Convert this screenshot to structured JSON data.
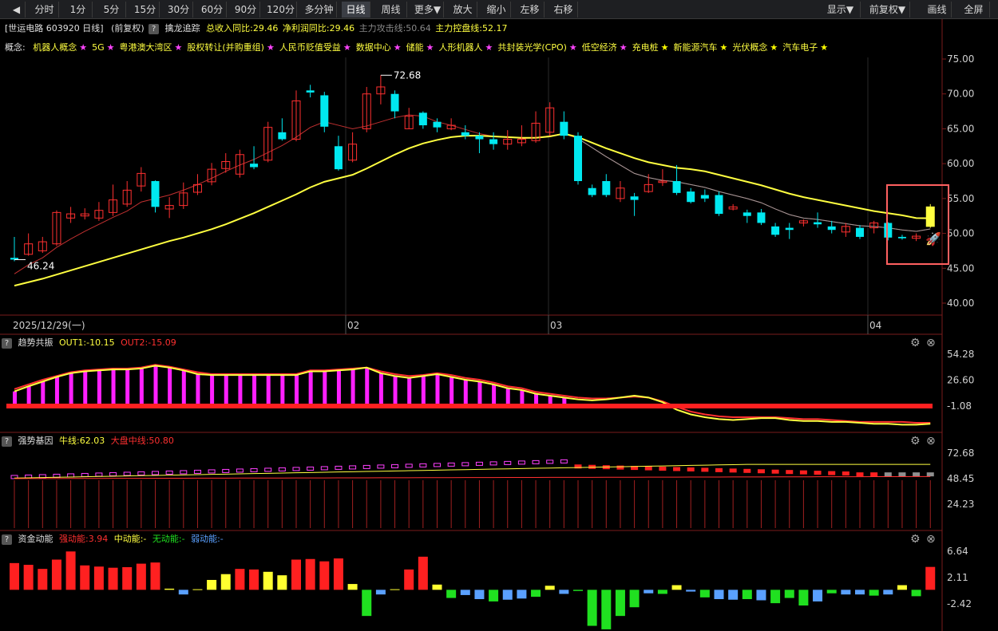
{
  "toolbar": {
    "nav_left": "◀",
    "periods": [
      "分时",
      "1分",
      "5分",
      "15分",
      "30分",
      "60分",
      "90分",
      "120分",
      "多分钟",
      "日线",
      "周线",
      "更多▼",
      "放大",
      "缩小",
      "左移",
      "右移"
    ],
    "active_period": "日线",
    "right_buttons": [
      "显示▼",
      "前复权▼",
      "画线",
      "全屏"
    ]
  },
  "info": {
    "stock": "[世运电路 603920 日线]",
    "adjust": "(前复权)",
    "indicator_name": "擒龙追踪",
    "revenue_yoy": "总收入同比:29.46",
    "profit_yoy": "净利润同比:29.46",
    "attack_line": "主力攻击线:50.64",
    "control_line": "主力控盘线:52.17"
  },
  "concepts": {
    "prefix": "概念:",
    "items": [
      {
        "label": "机器人概念",
        "star": "★",
        "star_color": "#ff44ff"
      },
      {
        "label": "5G",
        "star": "★",
        "star_color": "#ff44ff"
      },
      {
        "label": "粤港澳大湾区",
        "star": "★",
        "star_color": "#ff44ff"
      },
      {
        "label": "股权转让(并购重组)",
        "star": "★",
        "star_color": "#ff44ff"
      },
      {
        "label": "人民币贬值受益",
        "star": "★",
        "star_color": "#ff44ff"
      },
      {
        "label": "数据中心",
        "star": "★",
        "star_color": "#ff44ff"
      },
      {
        "label": "储能",
        "star": "★",
        "star_color": "#ff44ff"
      },
      {
        "label": "人形机器人",
        "star": "★",
        "star_color": "#ff44ff"
      },
      {
        "label": "共封装光学(CPO)",
        "star": "★",
        "star_color": "#ff44ff"
      },
      {
        "label": "低空经济",
        "star": "★",
        "star_color": "#ff44ff"
      },
      {
        "label": "充电桩",
        "star": "★",
        "star_color": "#ffff00"
      },
      {
        "label": "新能源汽车",
        "star": "★",
        "star_color": "#ffff00"
      },
      {
        "label": "光伏概念",
        "star": "★",
        "star_color": "#ffff00"
      },
      {
        "label": "汽车电子",
        "star": "★",
        "star_color": "#ffff00"
      }
    ]
  },
  "price_axis": [
    "75.00",
    "70.00",
    "65.00",
    "60.00",
    "55.00",
    "50.00",
    "45.00",
    "40.00"
  ],
  "date_axis": {
    "first": "2025/12/29(一)",
    "months": [
      "02",
      "03",
      "04"
    ]
  },
  "price_marks": {
    "high": "72.68",
    "low": "46.24"
  },
  "panels": {
    "trend": {
      "name": "趋势共振",
      "out1": "OUT1:-10.15",
      "out2": "OUT2:-15.09",
      "axis": [
        "54.28",
        "26.60",
        "-1.08"
      ]
    },
    "gene": {
      "name": "强势基因",
      "bull": "牛线:62.03",
      "market": "大盘中线:50.80",
      "axis": [
        "72.68",
        "48.45",
        "24.23"
      ]
    },
    "fund": {
      "name": "资金动能",
      "strong": "强动能:3.94",
      "mid": "中动能:-",
      "none": "无动能:-",
      "weak": "弱动能:-",
      "axis": [
        "6.64",
        "2.11",
        "-2.42"
      ]
    }
  },
  "colors": {
    "up": "#ff3030",
    "down": "#00e8f0",
    "ma_yellow": "#ffff40",
    "magenta": "#ff20ff"
  },
  "chart_data": {
    "type": "candlestick",
    "ylim": [
      38,
      77
    ],
    "x": [
      "2025/12/29",
      "",
      "",
      "",
      "",
      "",
      "",
      "",
      "",
      "",
      "",
      "",
      "",
      "",
      "",
      "",
      "",
      "",
      "",
      "",
      "",
      "",
      "",
      "",
      "",
      "02",
      "",
      "",
      "",
      "",
      "",
      "",
      "",
      "",
      "",
      "",
      "",
      "",
      "",
      "",
      "03",
      "",
      "",
      "",
      "",
      "",
      "",
      "",
      "",
      "",
      "",
      "",
      "",
      "",
      "",
      "",
      "",
      "",
      "",
      "",
      "",
      "",
      "",
      "04",
      "",
      "",
      "",
      ""
    ],
    "candles": [
      [
        46.5,
        46.24,
        46.0,
        49.5
      ],
      [
        47.0,
        48.5,
        46.8,
        50.0
      ],
      [
        47.5,
        48.8,
        47.2,
        49.5
      ],
      [
        48.5,
        53.0,
        48.2,
        53.3
      ],
      [
        52.2,
        52.8,
        51.5,
        53.8
      ],
      [
        52.5,
        52.8,
        52.0,
        53.6
      ],
      [
        52.2,
        53.3,
        51.8,
        54.5
      ],
      [
        53.0,
        54.8,
        52.5,
        57.0
      ],
      [
        54.2,
        56.2,
        53.8,
        57.5
      ],
      [
        56.8,
        58.6,
        56.0,
        59.5
      ],
      [
        57.5,
        53.8,
        53.0,
        57.6
      ],
      [
        53.5,
        54.0,
        52.2,
        55.2
      ],
      [
        54.0,
        55.8,
        53.5,
        57.3
      ],
      [
        55.9,
        57.0,
        55.5,
        58.5
      ],
      [
        57.4,
        59.2,
        56.9,
        60.1
      ],
      [
        59.3,
        60.3,
        58.7,
        61.5
      ],
      [
        58.5,
        61.3,
        58.0,
        62.0
      ],
      [
        60.0,
        59.5,
        59.2,
        62.5
      ],
      [
        60.5,
        65.2,
        60.2,
        66.0
      ],
      [
        64.5,
        63.5,
        63.3,
        66.5
      ],
      [
        63.5,
        69.0,
        63.2,
        70.5
      ],
      [
        70.5,
        70.2,
        69.5,
        71.3
      ],
      [
        69.8,
        65.3,
        64.5,
        70.3
      ],
      [
        62.5,
        59.2,
        59.0,
        64.0
      ],
      [
        60.5,
        62.8,
        60.2,
        64.5
      ],
      [
        65.0,
        70.0,
        64.5,
        71.0
      ],
      [
        70.0,
        71.0,
        68.5,
        72.68
      ],
      [
        70.0,
        67.5,
        66.5,
        70.5
      ],
      [
        65.0,
        66.8,
        65.0,
        68.0
      ],
      [
        67.3,
        65.5,
        65.0,
        67.5
      ],
      [
        66.0,
        65.2,
        64.5,
        66.5
      ],
      [
        65.0,
        65.5,
        64.8,
        66.5
      ],
      [
        64.5,
        64.0,
        63.5,
        65.5
      ],
      [
        64.0,
        63.5,
        61.5,
        64.5
      ],
      [
        63.5,
        62.8,
        62.0,
        64.5
      ],
      [
        62.8,
        63.5,
        62.0,
        64.8
      ],
      [
        63.0,
        63.5,
        62.5,
        65.5
      ],
      [
        63.3,
        65.8,
        63.0,
        67.5
      ],
      [
        64.5,
        68.0,
        64.0,
        68.8
      ],
      [
        66.0,
        64.0,
        63.5,
        67.5
      ],
      [
        64.0,
        57.5,
        57.0,
        64.5
      ],
      [
        56.5,
        55.5,
        55.2,
        57.0
      ],
      [
        57.5,
        55.5,
        55.2,
        58.5
      ],
      [
        55.0,
        56.5,
        54.5,
        57.5
      ],
      [
        55.3,
        54.8,
        52.5,
        55.8
      ],
      [
        56.0,
        57.0,
        55.8,
        58.5
      ],
      [
        57.3,
        57.5,
        56.8,
        59.2
      ],
      [
        57.5,
        55.8,
        55.5,
        59.8
      ],
      [
        56.0,
        54.5,
        54.3,
        56.5
      ],
      [
        55.5,
        55.0,
        54.5,
        56.3
      ],
      [
        55.5,
        52.8,
        52.5,
        56.0
      ],
      [
        53.5,
        53.8,
        53.3,
        54.2
      ],
      [
        53.0,
        52.5,
        51.5,
        53.4
      ],
      [
        53.0,
        51.5,
        51.2,
        53.5
      ],
      [
        51.0,
        49.8,
        49.5,
        51.5
      ],
      [
        50.8,
        50.5,
        49.2,
        51.5
      ],
      [
        51.5,
        51.8,
        51.0,
        52.0
      ],
      [
        51.6,
        51.3,
        50.8,
        53.0
      ],
      [
        51.0,
        50.5,
        50.0,
        51.8
      ],
      [
        50.2,
        51.0,
        49.5,
        51.5
      ],
      [
        50.8,
        49.5,
        49.2,
        51.2
      ],
      [
        50.8,
        51.5,
        50.0,
        51.8
      ],
      [
        51.5,
        49.4,
        49.0,
        51.6
      ],
      [
        49.5,
        49.3,
        49.1,
        49.8
      ],
      [
        49.3,
        49.6,
        48.9,
        50.0
      ],
      [
        51.0,
        53.8,
        50.8,
        54.2
      ]
    ],
    "series": [
      {
        "values": [
          44.2,
          45.5,
          46.5,
          48.0,
          49.2,
          50.3,
          51.3,
          52.3,
          53.2,
          54.5,
          55.0,
          55.5,
          56.2,
          57.0,
          57.9,
          58.9,
          59.8,
          60.6,
          61.6,
          62.6,
          63.8,
          65.2,
          66.0,
          65.5,
          65.0,
          65.4,
          66.0,
          66.6,
          67.0,
          66.8,
          66.0,
          65.5,
          64.9,
          64.3,
          63.9,
          63.8,
          63.6,
          63.7,
          64.0,
          64.3,
          63.6,
          62.3,
          61.0,
          59.8,
          58.6,
          58.0,
          57.6,
          57.4,
          57.0,
          56.6,
          56.0,
          55.5,
          55.0,
          54.4,
          53.5,
          52.7,
          52.2,
          52.0,
          51.7,
          51.4,
          51.1,
          51.0,
          50.8,
          50.5,
          50.3,
          50.64
        ]
      },
      {
        "values": [
          42.5,
          43.0,
          43.5,
          44.1,
          44.7,
          45.3,
          45.9,
          46.5,
          47.1,
          47.7,
          48.3,
          48.9,
          49.4,
          50.0,
          50.6,
          51.3,
          52.1,
          52.9,
          53.8,
          54.7,
          55.6,
          56.6,
          57.4,
          57.9,
          58.4,
          59.3,
          60.3,
          61.3,
          62.2,
          62.9,
          63.4,
          63.8,
          64.0,
          64.0,
          63.9,
          63.8,
          63.7,
          63.7,
          63.9,
          64.3,
          63.8,
          63.0,
          62.2,
          61.5,
          60.8,
          60.2,
          59.8,
          59.4,
          59.2,
          58.9,
          58.4,
          57.9,
          57.4,
          56.9,
          56.3,
          55.7,
          55.2,
          54.8,
          54.4,
          54.0,
          53.6,
          53.2,
          52.9,
          52.6,
          52.2,
          52.17
        ]
      }
    ]
  }
}
